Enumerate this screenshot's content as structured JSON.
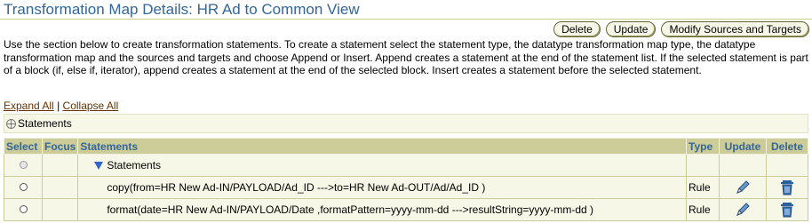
{
  "page": {
    "title": "Transformation Map Details: HR Ad to Common View"
  },
  "toolbar": {
    "delete_label": "Delete",
    "update_label": "Update",
    "modify_label": "Modify Sources and Targets"
  },
  "description": "Use the section below to create transformation statements. To create a statement select the statement type, the datatype transformation map type, the datatype transformation map and the sources and targets and choose Append or Insert. Append creates a statement at the end of the statement list. If the selected statement is part of a block (if, else if, iterator), append creates a statement at the end of the selected block. Insert creates a statement before the selected statement.",
  "expander": {
    "expand_all": "Expand All",
    "separator": "|",
    "collapse_all": "Collapse All"
  },
  "statements_section": {
    "label": "Statements"
  },
  "table": {
    "headers": {
      "select": "Select",
      "focus": "Focus",
      "statements": "Statements",
      "type": "Type",
      "update": "Update",
      "delete": "Delete"
    },
    "root_row": {
      "label": "Statements"
    },
    "rows": [
      {
        "statement": "copy(from=HR New Ad-IN/PAYLOAD/Ad_ID --->to=HR New Ad-OUT/Ad/Ad_ID )",
        "type": "Rule"
      },
      {
        "statement": "format(date=HR New Ad-IN/PAYLOAD/Date ,formatPattern=yyyy-mm-dd --->resultString=yyyy-mm-dd )",
        "type": "Rule"
      }
    ]
  },
  "icons": {
    "update": "pencil-icon",
    "delete": "trash-icon",
    "accent_color": "#336699",
    "header_bg": "#cccc99"
  }
}
